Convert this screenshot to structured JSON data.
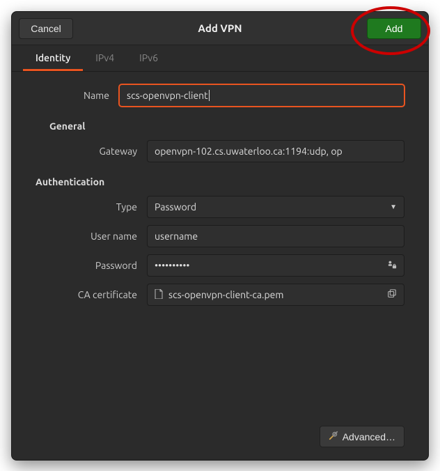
{
  "header": {
    "cancel_label": "Cancel",
    "title": "Add VPN",
    "add_label": "Add"
  },
  "tabs": {
    "identity": "Identity",
    "ipv4": "IPv4",
    "ipv6": "IPv6"
  },
  "form": {
    "name_label": "Name",
    "name_value": "scs-openvpn-client",
    "general_heading": "General",
    "gateway_label": "Gateway",
    "gateway_value": "openvpn-102.cs.uwaterloo.ca:1194:udp, op",
    "auth_heading": "Authentication",
    "type_label": "Type",
    "type_value": "Password",
    "username_label": "User name",
    "username_value": "username",
    "password_label": "Password",
    "password_value": "••••••••••",
    "ca_label": "CA certificate",
    "ca_value": "scs-openvpn-client-ca.pem"
  },
  "footer": {
    "advanced_label": "Advanced…"
  }
}
